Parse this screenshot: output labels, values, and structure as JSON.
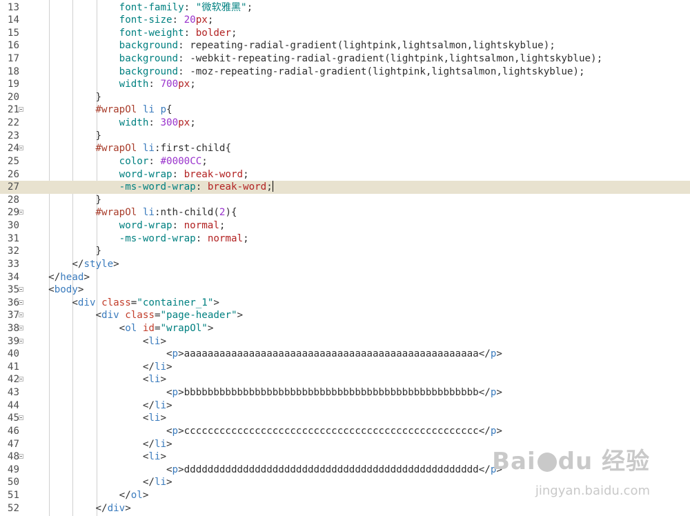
{
  "colors": {
    "property": "#008080",
    "value": "#b22222",
    "number": "#9932cc",
    "string": "#008080",
    "tag": "#3a7bbd",
    "attr": "#c23d2a",
    "selector": "#a83c2a",
    "pseudo": "#2f2f2f",
    "punct": "#2f2f2f",
    "text": "#2f2f2f",
    "current_line": "#e8e2cf",
    "gutter": "#4e4e4e"
  },
  "editor": {
    "current_line": 27,
    "lines": [
      {
        "n": "13",
        "fold": false,
        "indent": 4,
        "tokens": [
          {
            "t": "font-family",
            "c": "property"
          },
          {
            "t": ": ",
            "c": "punct"
          },
          {
            "t": "\"微软雅黑\"",
            "c": "string"
          },
          {
            "t": ";",
            "c": "punct"
          }
        ]
      },
      {
        "n": "14",
        "fold": false,
        "indent": 4,
        "tokens": [
          {
            "t": "font-size",
            "c": "property"
          },
          {
            "t": ": ",
            "c": "punct"
          },
          {
            "t": "20",
            "c": "number"
          },
          {
            "t": "px",
            "c": "value"
          },
          {
            "t": ";",
            "c": "punct"
          }
        ]
      },
      {
        "n": "15",
        "fold": false,
        "indent": 4,
        "tokens": [
          {
            "t": "font-weight",
            "c": "property"
          },
          {
            "t": ": ",
            "c": "punct"
          },
          {
            "t": "bolder",
            "c": "value"
          },
          {
            "t": ";",
            "c": "punct"
          }
        ]
      },
      {
        "n": "16",
        "fold": false,
        "indent": 4,
        "tokens": [
          {
            "t": "background",
            "c": "property"
          },
          {
            "t": ": ",
            "c": "punct"
          },
          {
            "t": "repeating-radial-gradient",
            "c": "text"
          },
          {
            "t": "(",
            "c": "punct"
          },
          {
            "t": "lightpink,lightsalmon,lightskyblue",
            "c": "text"
          },
          {
            "t": ");",
            "c": "punct"
          }
        ]
      },
      {
        "n": "17",
        "fold": false,
        "indent": 4,
        "tokens": [
          {
            "t": "background",
            "c": "property"
          },
          {
            "t": ": ",
            "c": "punct"
          },
          {
            "t": "-webkit-repeating-radial-gradient",
            "c": "text"
          },
          {
            "t": "(",
            "c": "punct"
          },
          {
            "t": "lightpink,lightsalmon,lightskyblue",
            "c": "text"
          },
          {
            "t": ");",
            "c": "punct"
          }
        ]
      },
      {
        "n": "18",
        "fold": false,
        "indent": 4,
        "tokens": [
          {
            "t": "background",
            "c": "property"
          },
          {
            "t": ": ",
            "c": "punct"
          },
          {
            "t": "-moz-repeating-radial-gradient",
            "c": "text"
          },
          {
            "t": "(",
            "c": "punct"
          },
          {
            "t": "lightpink,lightsalmon,lightskyblue",
            "c": "text"
          },
          {
            "t": ");",
            "c": "punct"
          }
        ]
      },
      {
        "n": "19",
        "fold": false,
        "indent": 4,
        "tokens": [
          {
            "t": "width",
            "c": "property"
          },
          {
            "t": ": ",
            "c": "punct"
          },
          {
            "t": "700",
            "c": "number"
          },
          {
            "t": "px",
            "c": "value"
          },
          {
            "t": ";",
            "c": "punct"
          }
        ]
      },
      {
        "n": "20",
        "fold": false,
        "indent": 3,
        "tokens": [
          {
            "t": "}",
            "c": "punct"
          }
        ]
      },
      {
        "n": "21",
        "fold": true,
        "indent": 3,
        "tokens": [
          {
            "t": "#wrapOl",
            "c": "selector"
          },
          {
            "t": " ",
            "c": "punct"
          },
          {
            "t": "li",
            "c": "tag"
          },
          {
            "t": " ",
            "c": "punct"
          },
          {
            "t": "p",
            "c": "tag"
          },
          {
            "t": "{",
            "c": "punct"
          }
        ]
      },
      {
        "n": "22",
        "fold": false,
        "indent": 4,
        "tokens": [
          {
            "t": "width",
            "c": "property"
          },
          {
            "t": ": ",
            "c": "punct"
          },
          {
            "t": "300",
            "c": "number"
          },
          {
            "t": "px",
            "c": "value"
          },
          {
            "t": ";",
            "c": "punct"
          }
        ]
      },
      {
        "n": "23",
        "fold": false,
        "indent": 3,
        "tokens": [
          {
            "t": "}",
            "c": "punct"
          }
        ]
      },
      {
        "n": "24",
        "fold": true,
        "indent": 3,
        "tokens": [
          {
            "t": "#wrapOl",
            "c": "selector"
          },
          {
            "t": " ",
            "c": "punct"
          },
          {
            "t": "li",
            "c": "tag"
          },
          {
            "t": ":first-child",
            "c": "pseudo"
          },
          {
            "t": "{",
            "c": "punct"
          }
        ]
      },
      {
        "n": "25",
        "fold": false,
        "indent": 4,
        "tokens": [
          {
            "t": "color",
            "c": "property"
          },
          {
            "t": ": ",
            "c": "punct"
          },
          {
            "t": "#0000CC",
            "c": "number"
          },
          {
            "t": ";",
            "c": "punct"
          }
        ]
      },
      {
        "n": "26",
        "fold": false,
        "indent": 4,
        "tokens": [
          {
            "t": "word-wrap",
            "c": "property"
          },
          {
            "t": ": ",
            "c": "punct"
          },
          {
            "t": "break-word",
            "c": "value"
          },
          {
            "t": ";",
            "c": "punct"
          }
        ]
      },
      {
        "n": "27",
        "fold": false,
        "indent": 4,
        "caret": true,
        "tokens": [
          {
            "t": "-ms-word-wrap",
            "c": "property"
          },
          {
            "t": ": ",
            "c": "punct"
          },
          {
            "t": "break-word",
            "c": "value"
          },
          {
            "t": ";",
            "c": "punct"
          }
        ]
      },
      {
        "n": "28",
        "fold": false,
        "indent": 3,
        "tokens": [
          {
            "t": "}",
            "c": "punct"
          }
        ]
      },
      {
        "n": "29",
        "fold": true,
        "indent": 3,
        "tokens": [
          {
            "t": "#wrapOl",
            "c": "selector"
          },
          {
            "t": " ",
            "c": "punct"
          },
          {
            "t": "li",
            "c": "tag"
          },
          {
            "t": ":nth-child",
            "c": "pseudo"
          },
          {
            "t": "(",
            "c": "punct"
          },
          {
            "t": "2",
            "c": "number"
          },
          {
            "t": "){",
            "c": "punct"
          }
        ]
      },
      {
        "n": "30",
        "fold": false,
        "indent": 4,
        "tokens": [
          {
            "t": "word-wrap",
            "c": "property"
          },
          {
            "t": ": ",
            "c": "punct"
          },
          {
            "t": "normal",
            "c": "value"
          },
          {
            "t": ";",
            "c": "punct"
          }
        ]
      },
      {
        "n": "31",
        "fold": false,
        "indent": 4,
        "tokens": [
          {
            "t": "-ms-word-wrap",
            "c": "property"
          },
          {
            "t": ": ",
            "c": "punct"
          },
          {
            "t": "normal",
            "c": "value"
          },
          {
            "t": ";",
            "c": "punct"
          }
        ]
      },
      {
        "n": "32",
        "fold": false,
        "indent": 3,
        "tokens": [
          {
            "t": "}",
            "c": "punct"
          }
        ]
      },
      {
        "n": "33",
        "fold": false,
        "indent": 2,
        "tokens": [
          {
            "t": "</",
            "c": "punct"
          },
          {
            "t": "style",
            "c": "tag"
          },
          {
            "t": ">",
            "c": "punct"
          }
        ]
      },
      {
        "n": "34",
        "fold": false,
        "indent": 1,
        "tokens": [
          {
            "t": "</",
            "c": "punct"
          },
          {
            "t": "head",
            "c": "tag"
          },
          {
            "t": ">",
            "c": "punct"
          }
        ]
      },
      {
        "n": "35",
        "fold": true,
        "indent": 1,
        "tokens": [
          {
            "t": "<",
            "c": "punct"
          },
          {
            "t": "body",
            "c": "tag"
          },
          {
            "t": ">",
            "c": "punct"
          }
        ]
      },
      {
        "n": "36",
        "fold": true,
        "indent": 2,
        "tokens": [
          {
            "t": "<",
            "c": "punct"
          },
          {
            "t": "div",
            "c": "tag"
          },
          {
            "t": " ",
            "c": "punct"
          },
          {
            "t": "class",
            "c": "attr"
          },
          {
            "t": "=",
            "c": "punct"
          },
          {
            "t": "\"container_1\"",
            "c": "string"
          },
          {
            "t": ">",
            "c": "punct"
          }
        ]
      },
      {
        "n": "37",
        "fold": true,
        "indent": 3,
        "tokens": [
          {
            "t": "<",
            "c": "punct"
          },
          {
            "t": "div",
            "c": "tag"
          },
          {
            "t": " ",
            "c": "punct"
          },
          {
            "t": "class",
            "c": "attr"
          },
          {
            "t": "=",
            "c": "punct"
          },
          {
            "t": "\"page-header\"",
            "c": "string"
          },
          {
            "t": ">",
            "c": "punct"
          }
        ]
      },
      {
        "n": "38",
        "fold": true,
        "indent": 4,
        "tokens": [
          {
            "t": "<",
            "c": "punct"
          },
          {
            "t": "ol",
            "c": "tag"
          },
          {
            "t": " ",
            "c": "punct"
          },
          {
            "t": "id",
            "c": "attr"
          },
          {
            "t": "=",
            "c": "punct"
          },
          {
            "t": "\"wrapOl\"",
            "c": "string"
          },
          {
            "t": ">",
            "c": "punct"
          }
        ]
      },
      {
        "n": "39",
        "fold": true,
        "indent": 5,
        "tokens": [
          {
            "t": "<",
            "c": "punct"
          },
          {
            "t": "li",
            "c": "tag"
          },
          {
            "t": ">",
            "c": "punct"
          }
        ]
      },
      {
        "n": "40",
        "fold": false,
        "indent": 6,
        "tokens": [
          {
            "t": "<",
            "c": "punct"
          },
          {
            "t": "p",
            "c": "tag"
          },
          {
            "t": ">",
            "c": "punct"
          },
          {
            "t": "aaaaaaaaaaaaaaaaaaaaaaaaaaaaaaaaaaaaaaaaaaaaaaaaaa",
            "c": "text"
          },
          {
            "t": "</",
            "c": "punct"
          },
          {
            "t": "p",
            "c": "tag"
          },
          {
            "t": ">",
            "c": "punct"
          }
        ]
      },
      {
        "n": "41",
        "fold": false,
        "indent": 5,
        "tokens": [
          {
            "t": "</",
            "c": "punct"
          },
          {
            "t": "li",
            "c": "tag"
          },
          {
            "t": ">",
            "c": "punct"
          }
        ]
      },
      {
        "n": "42",
        "fold": true,
        "indent": 5,
        "tokens": [
          {
            "t": "<",
            "c": "punct"
          },
          {
            "t": "li",
            "c": "tag"
          },
          {
            "t": ">",
            "c": "punct"
          }
        ]
      },
      {
        "n": "43",
        "fold": false,
        "indent": 6,
        "tokens": [
          {
            "t": "<",
            "c": "punct"
          },
          {
            "t": "p",
            "c": "tag"
          },
          {
            "t": ">",
            "c": "punct"
          },
          {
            "t": "bbbbbbbbbbbbbbbbbbbbbbbbbbbbbbbbbbbbbbbbbbbbbbbbbb",
            "c": "text"
          },
          {
            "t": "</",
            "c": "punct"
          },
          {
            "t": "p",
            "c": "tag"
          },
          {
            "t": ">",
            "c": "punct"
          }
        ]
      },
      {
        "n": "44",
        "fold": false,
        "indent": 5,
        "tokens": [
          {
            "t": "</",
            "c": "punct"
          },
          {
            "t": "li",
            "c": "tag"
          },
          {
            "t": ">",
            "c": "punct"
          }
        ]
      },
      {
        "n": "45",
        "fold": true,
        "indent": 5,
        "tokens": [
          {
            "t": "<",
            "c": "punct"
          },
          {
            "t": "li",
            "c": "tag"
          },
          {
            "t": ">",
            "c": "punct"
          }
        ]
      },
      {
        "n": "46",
        "fold": false,
        "indent": 6,
        "tokens": [
          {
            "t": "<",
            "c": "punct"
          },
          {
            "t": "p",
            "c": "tag"
          },
          {
            "t": ">",
            "c": "punct"
          },
          {
            "t": "cccccccccccccccccccccccccccccccccccccccccccccccccc",
            "c": "text"
          },
          {
            "t": "</",
            "c": "punct"
          },
          {
            "t": "p",
            "c": "tag"
          },
          {
            "t": ">",
            "c": "punct"
          }
        ]
      },
      {
        "n": "47",
        "fold": false,
        "indent": 5,
        "tokens": [
          {
            "t": "</",
            "c": "punct"
          },
          {
            "t": "li",
            "c": "tag"
          },
          {
            "t": ">",
            "c": "punct"
          }
        ]
      },
      {
        "n": "48",
        "fold": true,
        "indent": 5,
        "tokens": [
          {
            "t": "<",
            "c": "punct"
          },
          {
            "t": "li",
            "c": "tag"
          },
          {
            "t": ">",
            "c": "punct"
          }
        ]
      },
      {
        "n": "49",
        "fold": false,
        "indent": 6,
        "tokens": [
          {
            "t": "<",
            "c": "punct"
          },
          {
            "t": "p",
            "c": "tag"
          },
          {
            "t": ">",
            "c": "punct"
          },
          {
            "t": "dddddddddddddddddddddddddddddddddddddddddddddddddd",
            "c": "text"
          },
          {
            "t": "</",
            "c": "punct"
          },
          {
            "t": "p",
            "c": "tag"
          },
          {
            "t": ">",
            "c": "punct"
          }
        ]
      },
      {
        "n": "50",
        "fold": false,
        "indent": 5,
        "tokens": [
          {
            "t": "</",
            "c": "punct"
          },
          {
            "t": "li",
            "c": "tag"
          },
          {
            "t": ">",
            "c": "punct"
          }
        ]
      },
      {
        "n": "51",
        "fold": false,
        "indent": 4,
        "tokens": [
          {
            "t": "</",
            "c": "punct"
          },
          {
            "t": "ol",
            "c": "tag"
          },
          {
            "t": ">",
            "c": "punct"
          }
        ]
      },
      {
        "n": "52",
        "fold": false,
        "indent": 3,
        "tokens": [
          {
            "t": "</",
            "c": "punct"
          },
          {
            "t": "div",
            "c": "tag"
          },
          {
            "t": ">",
            "c": "punct"
          }
        ]
      }
    ]
  },
  "watermark": {
    "brand_left": "Bai",
    "brand_right": "du",
    "brand_cn": "经验",
    "url": "jingyan.baidu.com",
    "icon": "paw-icon"
  }
}
